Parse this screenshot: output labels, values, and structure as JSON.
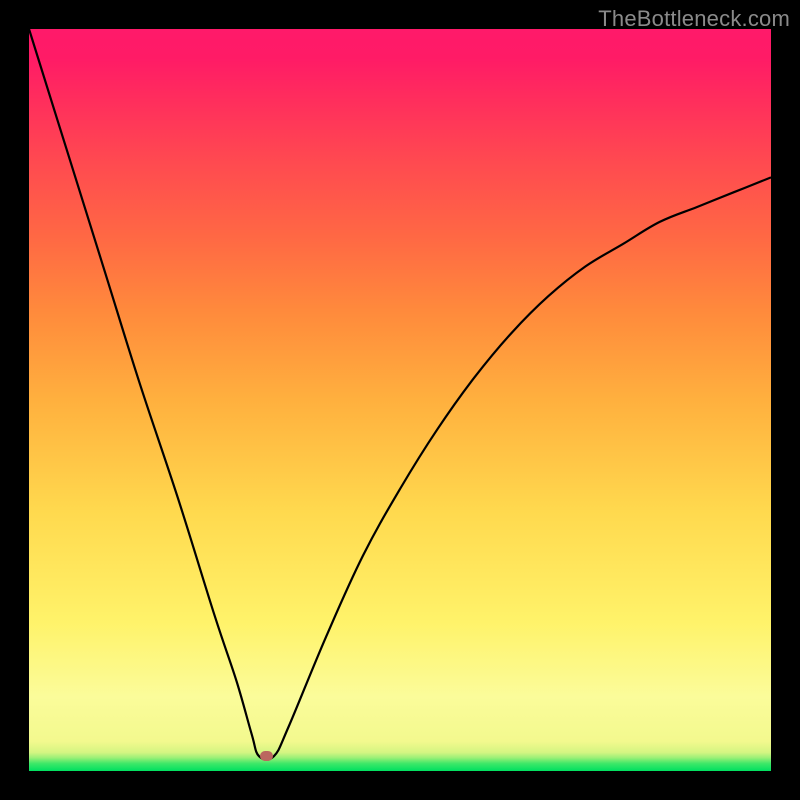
{
  "watermark": "TheBottleneck.com",
  "colors": {
    "frame": "#000000",
    "curve": "#000000",
    "marker": "#bb675f"
  },
  "chart_data": {
    "type": "line",
    "title": "",
    "xlabel": "",
    "ylabel": "",
    "xlim": [
      0,
      100
    ],
    "ylim": [
      0,
      100
    ],
    "grid": false,
    "legend": false,
    "series": [
      {
        "name": "bottleneck-curve",
        "x": [
          0,
          5,
          10,
          15,
          20,
          25,
          28,
          30,
          31,
          33,
          35,
          40,
          45,
          50,
          55,
          60,
          65,
          70,
          75,
          80,
          85,
          90,
          95,
          100
        ],
        "y": [
          100,
          84,
          68,
          52,
          37,
          21,
          12,
          5,
          2,
          2,
          6,
          18,
          29,
          38,
          46,
          53,
          59,
          64,
          68,
          71,
          74,
          76,
          78,
          80
        ]
      }
    ],
    "marker": {
      "x": 32,
      "y": 2
    },
    "background_gradient": {
      "direction": "bottom-to-top",
      "stops": [
        {
          "pos": 0.0,
          "color": "#00e060"
        },
        {
          "pos": 0.02,
          "color": "#9cf077"
        },
        {
          "pos": 0.1,
          "color": "#fbfc9a"
        },
        {
          "pos": 0.35,
          "color": "#ffd94e"
        },
        {
          "pos": 0.62,
          "color": "#ff8a3c"
        },
        {
          "pos": 0.82,
          "color": "#ff4a50"
        },
        {
          "pos": 1.0,
          "color": "#ff1a6a"
        }
      ]
    }
  }
}
